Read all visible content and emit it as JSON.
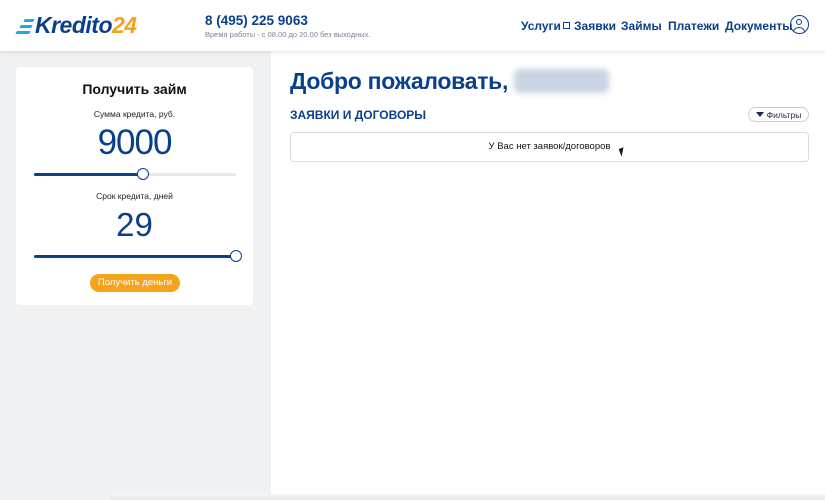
{
  "header": {
    "logo": {
      "brand": "Kredito",
      "number": "24"
    },
    "phone": "8 (495) 225 9063",
    "hours": "Время работы - с 08.00 до 20.00 без выходных.",
    "nav": [
      {
        "label": "Услуги",
        "external": true
      },
      {
        "label": "Заявки"
      },
      {
        "label": "Займы"
      },
      {
        "label": "Платежи"
      },
      {
        "label": "Документы"
      }
    ]
  },
  "loan": {
    "title": "Получить займ",
    "sum_label": "Сумма кредита, руб.",
    "sum_value": "9000",
    "sum_fraction": 0.54,
    "term_label": "Срок кредита, дней",
    "term_value": "29",
    "term_fraction": 1.0,
    "button": "Получить деньги"
  },
  "main": {
    "welcome": "Добро пожаловать,",
    "section_title": "ЗАЯВКИ И ДОГОВОРЫ",
    "filter_label": "Фильтры",
    "empty_message": "У Вас нет заявок/договоров"
  },
  "colors": {
    "primary": "#0a3f8c",
    "accent": "#f5a31a",
    "logo_stripes": "#1fa8e0"
  }
}
